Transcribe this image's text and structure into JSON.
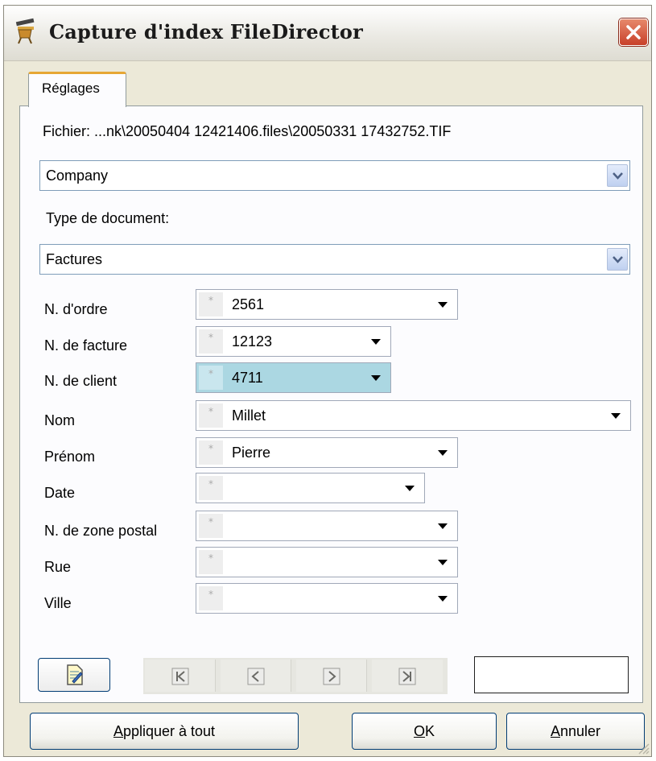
{
  "window": {
    "title": "Capture d'index FileDirector",
    "icon": "filedirector-app-icon"
  },
  "tab": {
    "label": "Réglages"
  },
  "file": {
    "path_text": "Fichier: ...nk\\20050404 12421406.files\\20050331 17432752.TIF"
  },
  "company_select": {
    "value": "Company"
  },
  "doctype": {
    "label": "Type de document:",
    "value": "Factures"
  },
  "fields": [
    {
      "label": "N. d'ordre",
      "value": "2561"
    },
    {
      "label": "N. de facture",
      "value": "12123"
    },
    {
      "label": "N. de client",
      "value": "4711"
    },
    {
      "label": "Nom",
      "value": "Millet"
    },
    {
      "label": "Prénom",
      "value": "Pierre"
    },
    {
      "label": "Date",
      "value": ""
    },
    {
      "label": "N. de zone postal",
      "value": ""
    },
    {
      "label": "Rue",
      "value": ""
    },
    {
      "label": "Ville",
      "value": ""
    }
  ],
  "field_marker": "*",
  "navigation": {
    "icons": [
      "first-page-icon",
      "previous-page-icon",
      "next-page-icon",
      "last-page-icon"
    ],
    "count_text": ""
  },
  "buttons": {
    "apply_all": {
      "text": "ppliquer à tout",
      "accel": "A"
    },
    "ok": {
      "text": "K",
      "accel": "O"
    },
    "cancel": {
      "text": "nnuler",
      "accel": "A"
    }
  },
  "colors": {
    "window_bg": "#ece9d8",
    "active_field": "#abd7e2",
    "close_button": "#c8402a",
    "tab_accent": "#e6a734"
  }
}
